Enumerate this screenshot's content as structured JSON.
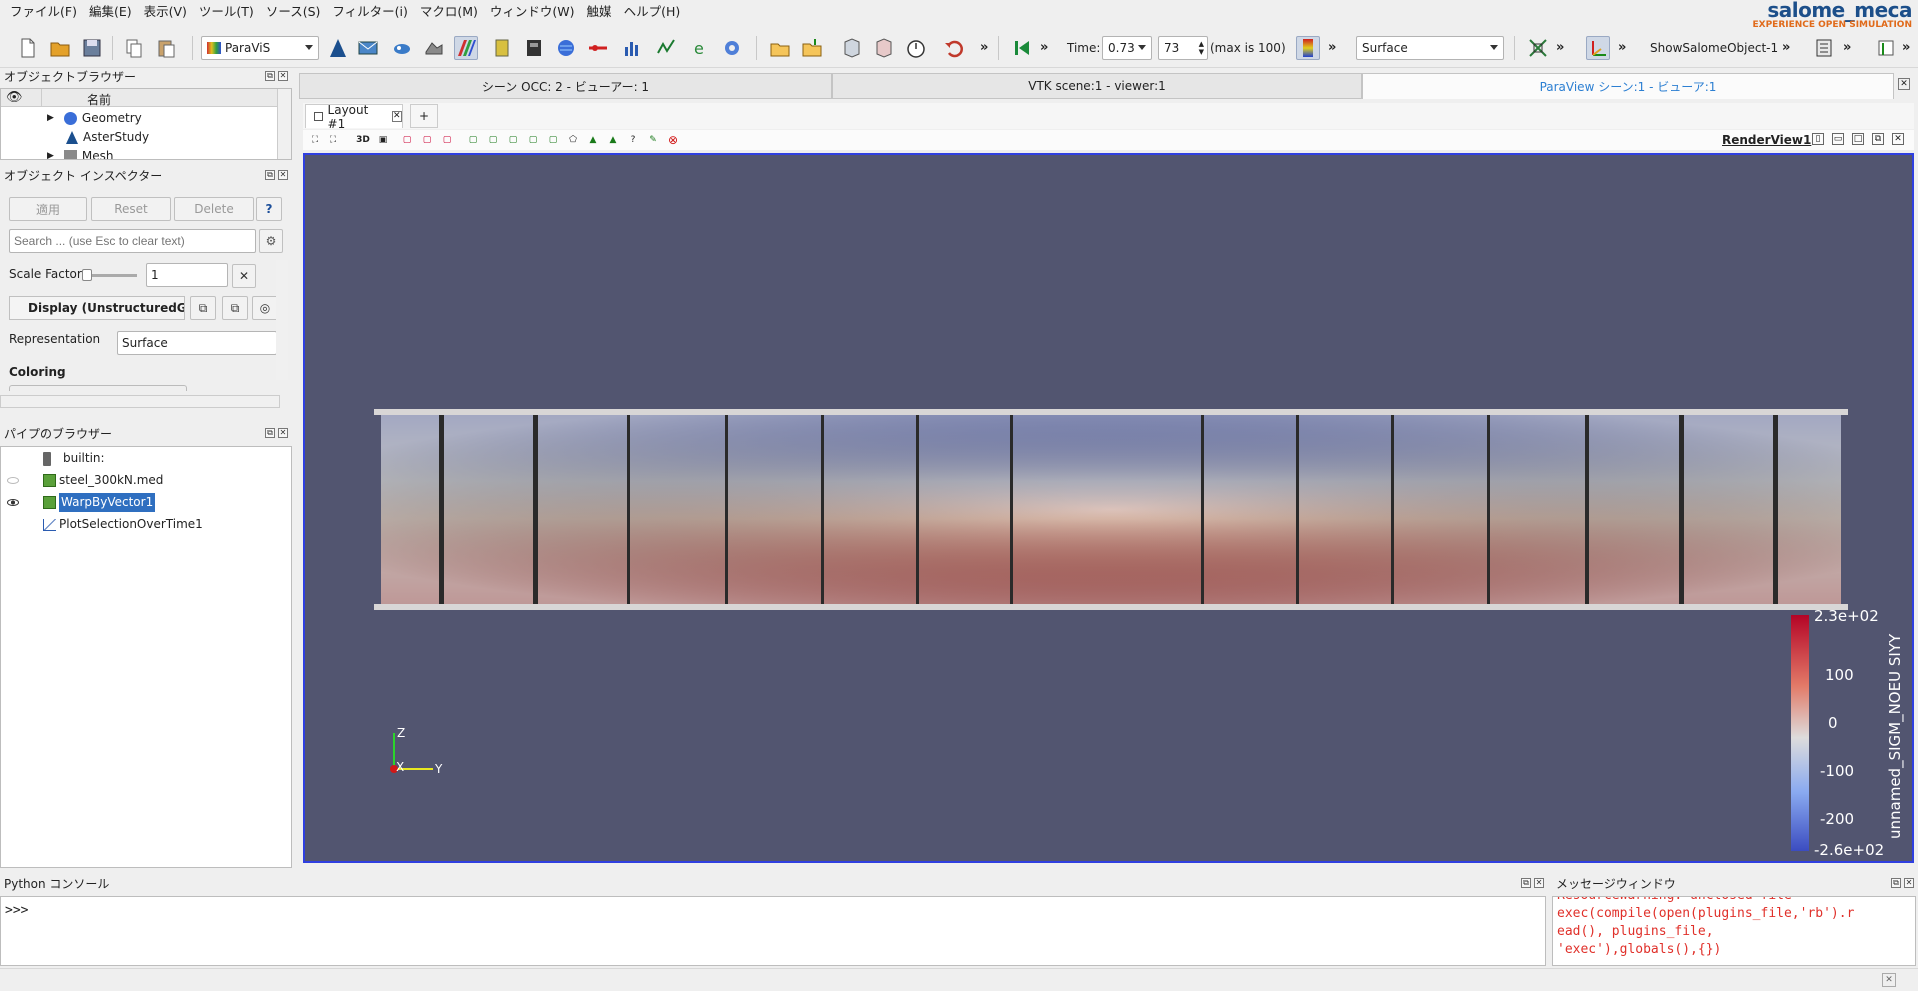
{
  "menu": [
    "ファイル(F)",
    "編集(E)",
    "表示(V)",
    "ツール(T)",
    "ソース(S)",
    "フィルター(i)",
    "マクロ(M)",
    "ウィンドウ(W)",
    "触媒",
    "ヘルプ(H)"
  ],
  "brand": {
    "title": "salome_meca",
    "subtitle": "EXPERIENCE OPEN SIMULATION"
  },
  "toolbar": {
    "module_combo": "ParaViS",
    "time_label": "Time:",
    "time_value": "0.73",
    "step_value": "73",
    "max_label": "(max is 100)",
    "representation": "Surface",
    "show_object": "ShowSalomeObject-1",
    "more": "»"
  },
  "object_browser": {
    "title": "オブジェクトブラウザー",
    "column": "名前",
    "items": [
      "Geometry",
      "AsterStudy",
      "Mesh"
    ]
  },
  "inspector": {
    "title": "オブジェクト インスペクター",
    "apply": "適用",
    "reset": "Reset",
    "delete": "Delete",
    "help": "?",
    "search_placeholder": "Search ... (use Esc to clear text)",
    "scale_label": "Scale Factor",
    "scale_value": "1",
    "display_label": "Display (UnstructuredG",
    "representation_label": "Representation",
    "representation_value": "Surface",
    "coloring_label": "Coloring"
  },
  "pipeline": {
    "title": "パイプのブラウザー",
    "items": [
      "builtin:",
      "steel_300kN.med",
      "WarpByVector1",
      "PlotSelectionOverTime1"
    ]
  },
  "tabs": [
    "シーン OCC: 2 - ビューアー: 1",
    "VTK scene:1 - viewer:1",
    "ParaView シーン:1 - ビューア:1"
  ],
  "layout_tab": "Layout #1",
  "add_tab": "+",
  "view_toolbar": {
    "mode3d": "3D",
    "render_view": "RenderView1"
  },
  "colorbar": {
    "title": "unnamed_SIGM_NOEU SIYY",
    "labels": [
      "2.3e+02",
      "100",
      "0",
      "-100",
      "-200",
      "-2.6e+02"
    ]
  },
  "axes": {
    "z": "Z",
    "x": "X",
    "y": "Y"
  },
  "python_console": {
    "title": "Python コンソール",
    "prompt": ">>>"
  },
  "message_window": {
    "title": "メッセージウィンドウ",
    "lines": [
      "ResourceWarning: unclosed file",
      "exec(compile(open(plugins_file,'rb').r",
      "ead(), plugins_file,",
      "'exec'),globals(),{})"
    ]
  },
  "colors": {
    "viewport_bg": "#525570",
    "accent": "#2f3fe0",
    "stress_high": "#b7161c",
    "stress_low": "#3b4fd0"
  }
}
